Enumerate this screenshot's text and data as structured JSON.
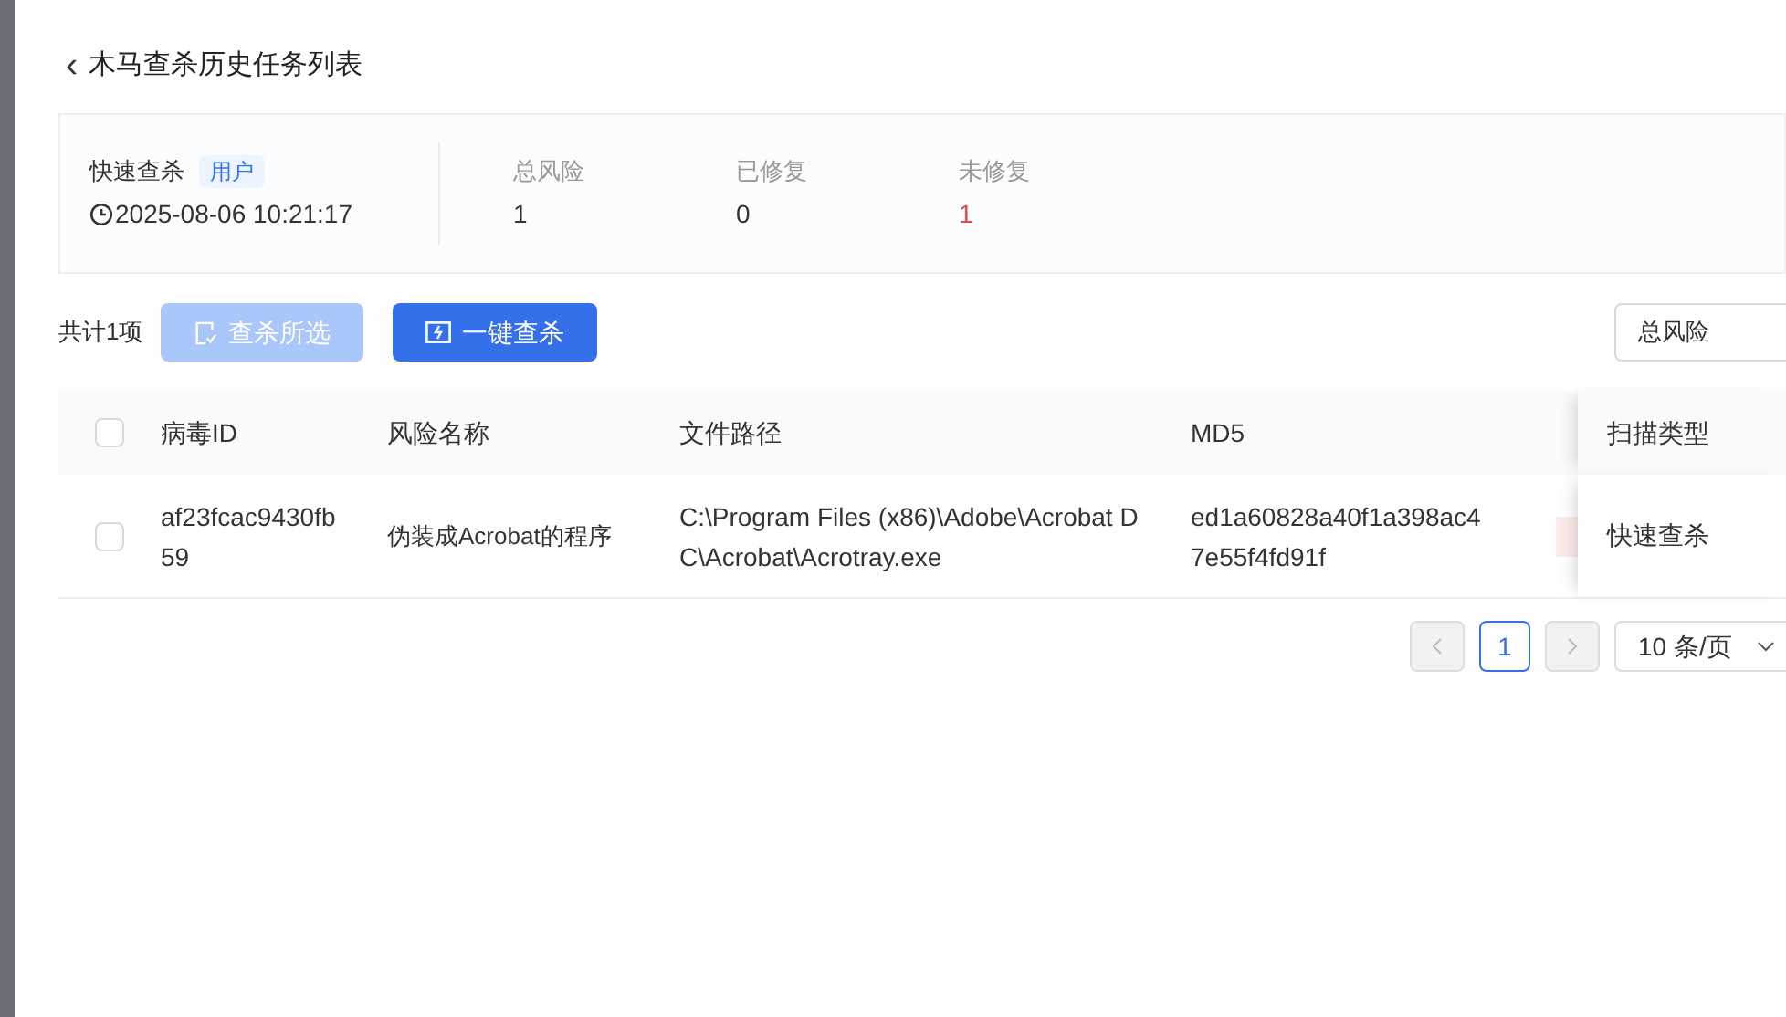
{
  "header": {
    "back": "‹",
    "title": "木马查杀历史任务列表"
  },
  "summary": {
    "scan_type": "快速查杀",
    "tag": "用户",
    "time": "2025-08-06 10:21:17",
    "stats": [
      {
        "label": "总风险",
        "value": "1",
        "kind": "normal"
      },
      {
        "label": "已修复",
        "value": "0",
        "kind": "normal"
      },
      {
        "label": "未修复",
        "value": "1",
        "kind": "alert"
      }
    ]
  },
  "toolbar": {
    "total": "共计1项",
    "buttons": [
      {
        "label": "查杀所选",
        "disabled": true
      },
      {
        "label": "一键查杀",
        "disabled": false
      }
    ],
    "sort_select": {
      "value": "总风险"
    }
  },
  "table": {
    "columns": [
      "病毒ID",
      "风险名称",
      "文件路径",
      "MD5",
      "扫描类型"
    ],
    "rows": [
      {
        "checked": false,
        "virus_id": "af23fcac9430fb59",
        "risk_name": "伪装成Acrobat的程序",
        "file_path": "C:\\Program Files (x86)\\Adobe\\Acrobat DC\\Acrobat\\Acrotray.exe",
        "md5": "ed1a60828a40f1a398ac47e55f4fd91f",
        "scan_type": "快速查杀"
      }
    ],
    "header_checked": false
  },
  "pagination": {
    "pages": [
      {
        "label": "1",
        "selected": true
      }
    ],
    "page_size": "10 条/页"
  }
}
